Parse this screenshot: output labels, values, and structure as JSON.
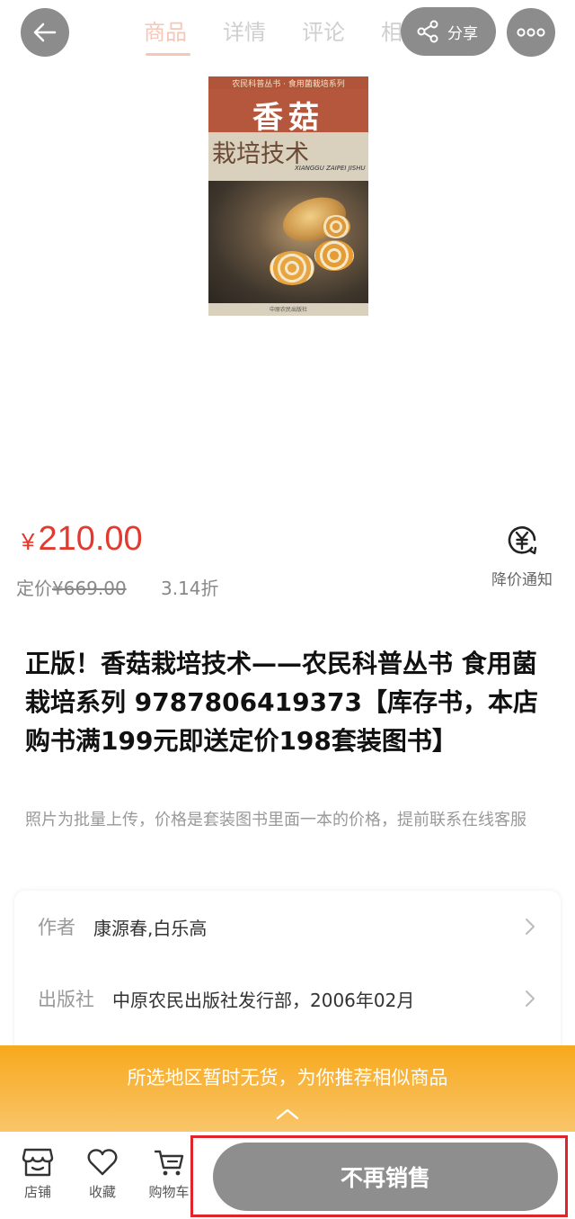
{
  "header": {
    "tabs": [
      {
        "label": "商品",
        "active": true
      },
      {
        "label": "详情",
        "active": false
      },
      {
        "label": "评论",
        "active": false
      },
      {
        "label": "相关",
        "active": false
      }
    ],
    "share_label": "分享",
    "back_icon": "back-arrow-icon",
    "more_icon": "more-dots-icon"
  },
  "cover": {
    "series_text": "农民科普丛书 · 食用菌栽培系列",
    "title_text": "香菇",
    "subtitle_text": "栽培技术",
    "pinyin_text": "XIANGGU ZAIPEI JISHU",
    "publisher_text": "中原农民出版社"
  },
  "price": {
    "currency": "¥",
    "current": "210.00",
    "list_prefix": "定价",
    "list_price": "¥669.00",
    "discount": "3.14折",
    "notify_label": "降价通知"
  },
  "product": {
    "title": "正版！香菇栽培技术——农民科普丛书 食用菌栽培系列 9787806419373【库存书，本店购书满199元即送定价198套装图书】",
    "subtitle": "照片为批量上传，价格是套装图书里面一本的价格，提前联系在线客服"
  },
  "attributes": [
    {
      "key": "作者",
      "value": "康源春,白乐高"
    },
    {
      "key": "出版社",
      "value": "中原农民出版社发行部，2006年02月"
    }
  ],
  "banner": {
    "text": "所选地区暂时无货，为你推荐相似商品"
  },
  "bottom_nav": {
    "items": [
      {
        "label": "店铺",
        "icon": "store-icon"
      },
      {
        "label": "收藏",
        "icon": "heart-icon"
      },
      {
        "label": "购物车",
        "icon": "cart-icon"
      }
    ],
    "action_label": "不再销售"
  },
  "colors": {
    "price_red": "#e23a2e",
    "banner_orange": "#f7a91c",
    "disabled_gray": "#8e8e8e",
    "highlight_red": "#e0242c"
  }
}
